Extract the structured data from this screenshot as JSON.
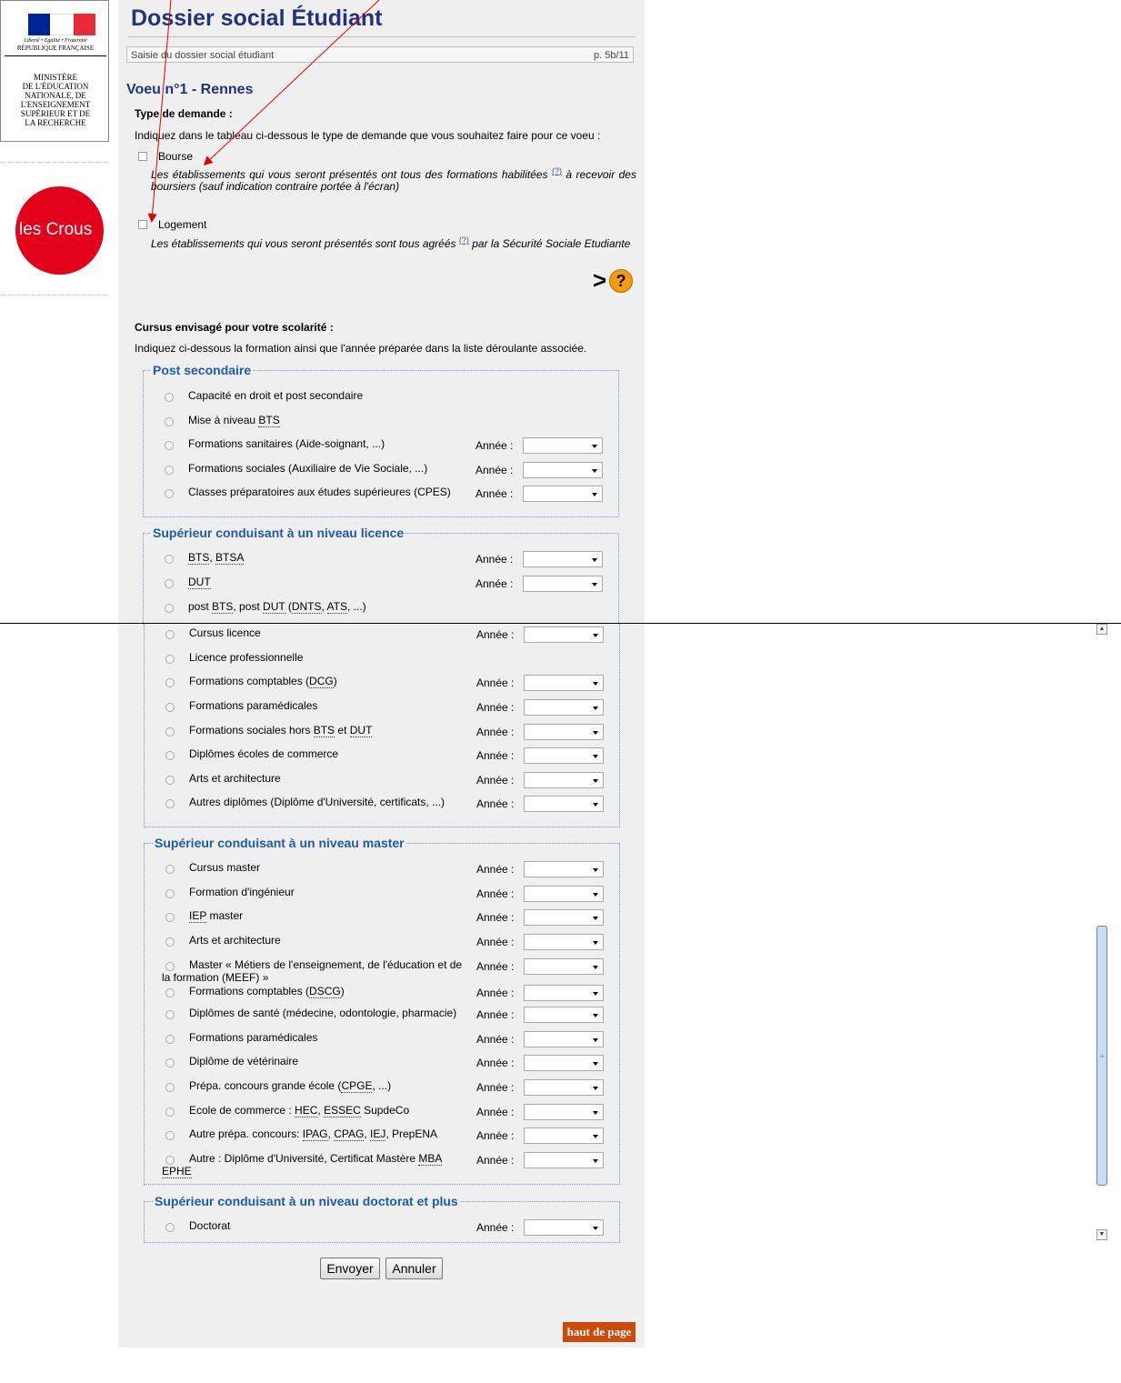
{
  "sidebar": {
    "devise": "Liberté • Égalité • Fraternité",
    "republique": "RÉPUBLIQUE FRANÇAISE",
    "ministere": "MINISTÈRE\nDE L'ÉDUCATION\nNATIONALE, DE\nL'ENSEIGNEMENT\nSUPÉRIEUR ET DE\nLA RECHERCHE",
    "crous_logo_text": "les Crous"
  },
  "header": {
    "title": "Dossier social Étudiant",
    "subtitle": "Saisie du dossier social étudiant",
    "page": "p. 5b/11"
  },
  "voeu": {
    "title": "Voeu n°1 - Rennes",
    "type_heading": "Type de demande :",
    "type_instruction": "Indiquez dans le tableau ci-dessous le type de demande que vous souhaitez faire pour ce voeu :",
    "bourse_label": "Bourse",
    "bourse_note_1": "Les établissements qui vous seront présentés ont tous des formations habilitées",
    "bourse_note_2": "à recevoir des boursiers (sauf indication contraire portée à l'écran)",
    "logement_label": "Logement",
    "logement_note_1": "Les établissements qui vous seront présentés sont tous agréés",
    "logement_note_2": "par la Sécurité Sociale Etudiante",
    "info_marker": "(?)",
    "help_marker": ">",
    "help_symbol": "?"
  },
  "cursus": {
    "heading": "Cursus envisagé pour votre scolarité :",
    "instruction": "Indiquez ci-dessous la formation ainsi que l'année préparée dans la liste déroulante associée.",
    "annee_label": "Année :"
  },
  "groups": {
    "post_secondaire": {
      "legend": "Post secondaire",
      "items": [
        {
          "label": "Capacité en droit et post secondaire"
        },
        {
          "label": "Mise à niveau BTS"
        },
        {
          "label": "Formations sanitaires (Aide-soignant, ...)"
        },
        {
          "label": "Formations sociales (Auxiliaire de Vie Sociale, ...)"
        },
        {
          "label": "Classes préparatoires aux études supérieures (CPES)"
        }
      ]
    },
    "licence": {
      "legend": "Supérieur conduisant à un niveau licence",
      "items": [
        {
          "label": "BTS, BTSA"
        },
        {
          "label": "DUT"
        },
        {
          "label": "post BTS, post DUT (DNTS, ATS, ...)"
        },
        {
          "label": "Cursus licence"
        },
        {
          "label": "Licence professionnelle"
        },
        {
          "label": "Formations comptables (DCG)"
        },
        {
          "label": "Formations paramédicales"
        },
        {
          "label": "Formations sociales hors BTS et DUT"
        },
        {
          "label": "Diplômes écoles de commerce"
        },
        {
          "label": "Arts et architecture"
        },
        {
          "label": "Autres diplômes (Diplôme d'Université, certificats, ...)"
        }
      ]
    },
    "master": {
      "legend": "Supérieur conduisant à un niveau master",
      "items": [
        {
          "label": "Cursus master"
        },
        {
          "label": "Formation d'ingénieur"
        },
        {
          "label": "IEP master"
        },
        {
          "label": "Arts et architecture"
        },
        {
          "label": "Master « Métiers de l'enseignement, de l'éducation et de",
          "label2": "la formation (MEEF) »"
        },
        {
          "label": "Formations comptables (DSCG)"
        },
        {
          "label": "Diplômes de santé (médecine, odontologie, pharmacie)"
        },
        {
          "label": "Formations paramédicales"
        },
        {
          "label": "Diplôme de vétérinaire"
        },
        {
          "label": "Prépa. concours grande école (CPGE, ...)"
        },
        {
          "label": "Ecole de commerce : HEC, ESSEC SupdeCo"
        },
        {
          "label": "Autre prépa. concours: IPAG, CPAG, IEJ, PrepENA"
        },
        {
          "label": "Autre : Diplôme d'Université, Certificat Mastère MBA",
          "label2": "EPHE"
        }
      ]
    },
    "doctorat": {
      "legend": "Supérieur conduisant à un niveau doctorat et plus",
      "items": [
        {
          "label": "Doctorat"
        }
      ]
    }
  },
  "actions": {
    "envoyer": "Envoyer",
    "annuler": "Annuler",
    "haut_de_page": "haut de page"
  },
  "colors": {
    "title_blue": "#22327b",
    "legend_blue": "#1c5ca8",
    "annotation_red": "#e00000",
    "crous_red": "#e2001a",
    "haut_orange": "#cc4b0c"
  }
}
